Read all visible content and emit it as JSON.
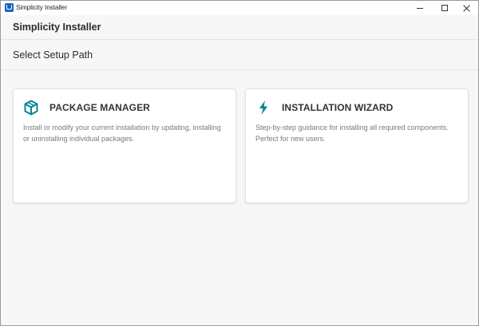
{
  "window": {
    "title": "Simplicity Installer"
  },
  "header": {
    "title": "Simplicity Installer"
  },
  "section": {
    "title": "Select Setup Path"
  },
  "cards": [
    {
      "icon": "package-icon",
      "title": "PACKAGE MANAGER",
      "description": "Install or modify your current installation by updating, installing or uninstalling individual packages."
    },
    {
      "icon": "lightning-bolt-icon",
      "title": "INSTALLATION WIZARD",
      "description": "Step-by-step guidance for installing all required components. Perfect for new users."
    }
  ],
  "colors": {
    "accent": "#00838f",
    "app_icon": "#1565c0",
    "background": "#f7f7f7",
    "card": "#ffffff"
  }
}
